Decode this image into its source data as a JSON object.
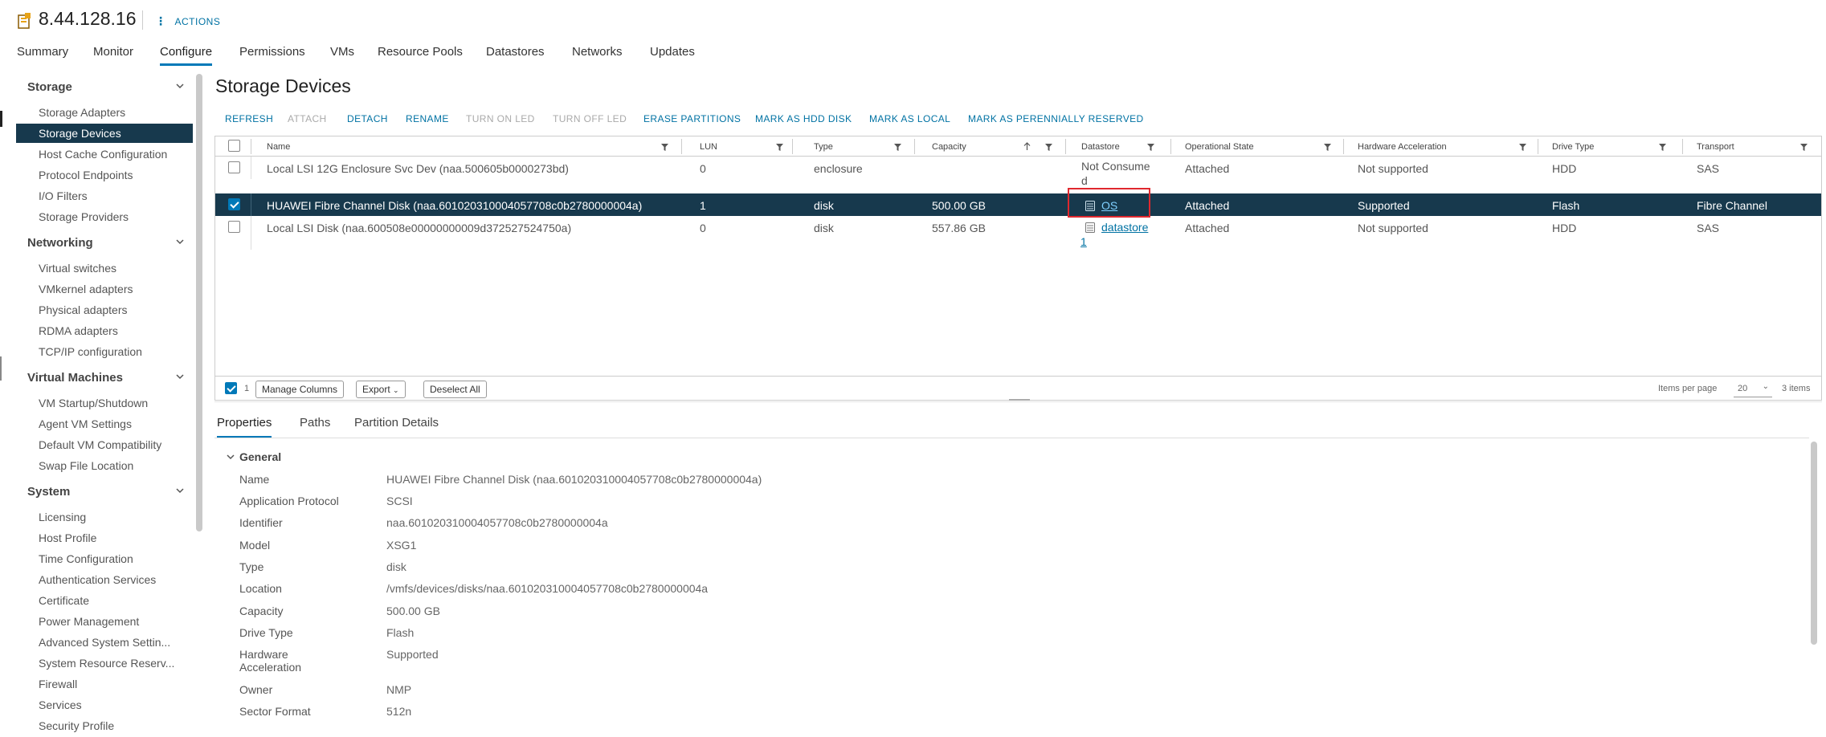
{
  "header": {
    "title": "8.44.128.16",
    "actions_label": "ACTIONS"
  },
  "tabs": [
    "Summary",
    "Monitor",
    "Configure",
    "Permissions",
    "VMs",
    "Resource Pools",
    "Datastores",
    "Networks",
    "Updates"
  ],
  "active_tab": "Configure",
  "sidebar": {
    "sections": [
      {
        "title": "Storage",
        "items": [
          "Storage Adapters",
          "Storage Devices",
          "Host Cache Configuration",
          "Protocol Endpoints",
          "I/O Filters",
          "Storage Providers"
        ]
      },
      {
        "title": "Networking",
        "items": [
          "Virtual switches",
          "VMkernel adapters",
          "Physical adapters",
          "RDMA adapters",
          "TCP/IP configuration"
        ]
      },
      {
        "title": "Virtual Machines",
        "items": [
          "VM Startup/Shutdown",
          "Agent VM Settings",
          "Default VM Compatibility",
          "Swap File Location"
        ]
      },
      {
        "title": "System",
        "items": [
          "Licensing",
          "Host Profile",
          "Time Configuration",
          "Authentication Services",
          "Certificate",
          "Power Management",
          "Advanced System Settin...",
          "System Resource Reserv...",
          "Firewall",
          "Services",
          "Security Profile"
        ]
      }
    ],
    "active_item": "Storage Devices"
  },
  "main": {
    "title": "Storage Devices",
    "toolbar": [
      {
        "label": "REFRESH",
        "enabled": true
      },
      {
        "label": "ATTACH",
        "enabled": false
      },
      {
        "label": "DETACH",
        "enabled": true
      },
      {
        "label": "RENAME",
        "enabled": true
      },
      {
        "label": "TURN ON LED",
        "enabled": false
      },
      {
        "label": "TURN OFF LED",
        "enabled": false
      },
      {
        "label": "ERASE PARTITIONS",
        "enabled": true
      },
      {
        "label": "MARK AS HDD DISK",
        "enabled": true
      },
      {
        "label": "MARK AS LOCAL",
        "enabled": true
      },
      {
        "label": "MARK AS PERENNIALLY RESERVED",
        "enabled": true
      }
    ],
    "columns": [
      "Name",
      "LUN",
      "Type",
      "Capacity",
      "Datastore",
      "Operational State",
      "Hardware Acceleration",
      "Drive Type",
      "Transport"
    ],
    "rows": [
      {
        "name": "Local LSI 12G Enclosure Svc Dev (naa.500605b0000273bd)",
        "lun": "0",
        "type": "enclosure",
        "capacity": "",
        "datastore": "Not Consume",
        "datastore2": "d",
        "ds_link": false,
        "state": "Attached",
        "hwaccel": "Not supported",
        "drive": "HDD",
        "transport": "SAS",
        "selected": false
      },
      {
        "name": "HUAWEI Fibre Channel Disk (naa.601020310004057708c0b2780000004a)",
        "lun": "1",
        "type": "disk",
        "capacity": "500.00 GB",
        "datastore": "OS",
        "datastore2": "",
        "ds_link": true,
        "state": "Attached",
        "hwaccel": "Supported",
        "drive": "Flash",
        "transport": "Fibre Channel",
        "selected": true
      },
      {
        "name": "Local LSI Disk (naa.600508e00000000009d372527524750a)",
        "lun": "0",
        "type": "disk",
        "capacity": "557.86 GB",
        "datastore": "datastore",
        "datastore2": "1",
        "ds_link": true,
        "state": "Attached",
        "hwaccel": "Not supported",
        "drive": "HDD",
        "transport": "SAS",
        "selected": false
      }
    ],
    "footer": {
      "selected_count": "1",
      "manage_columns": "Manage Columns",
      "export": "Export",
      "deselect_all": "Deselect All",
      "items_per_page_label": "Items per page",
      "items_per_page": "20",
      "total": "3 items"
    }
  },
  "details": {
    "tabs": [
      "Properties",
      "Paths",
      "Partition Details"
    ],
    "active_tab": "Properties",
    "section": "General",
    "properties": [
      {
        "key": "Name",
        "value": "HUAWEI Fibre Channel Disk (naa.601020310004057708c0b2780000004a)"
      },
      {
        "key": "Application Protocol",
        "value": "SCSI"
      },
      {
        "key": "Identifier",
        "value": "naa.601020310004057708c0b2780000004a"
      },
      {
        "key": "Model",
        "value": "XSG1"
      },
      {
        "key": "Type",
        "value": "disk"
      },
      {
        "key": "Location",
        "value": "/vmfs/devices/disks/naa.601020310004057708c0b2780000004a"
      },
      {
        "key": "Capacity",
        "value": "500.00 GB"
      },
      {
        "key": "Drive Type",
        "value": "Flash"
      },
      {
        "key": "Hardware Acceleration",
        "value": "Supported"
      },
      {
        "key": "Owner",
        "value": "NMP"
      },
      {
        "key": "Sector Format",
        "value": "512n"
      }
    ]
  },
  "colors": {
    "accent": "#0079b8",
    "link": "#0072a3",
    "selected_row": "#17394d",
    "highlight": "#e0282e"
  }
}
